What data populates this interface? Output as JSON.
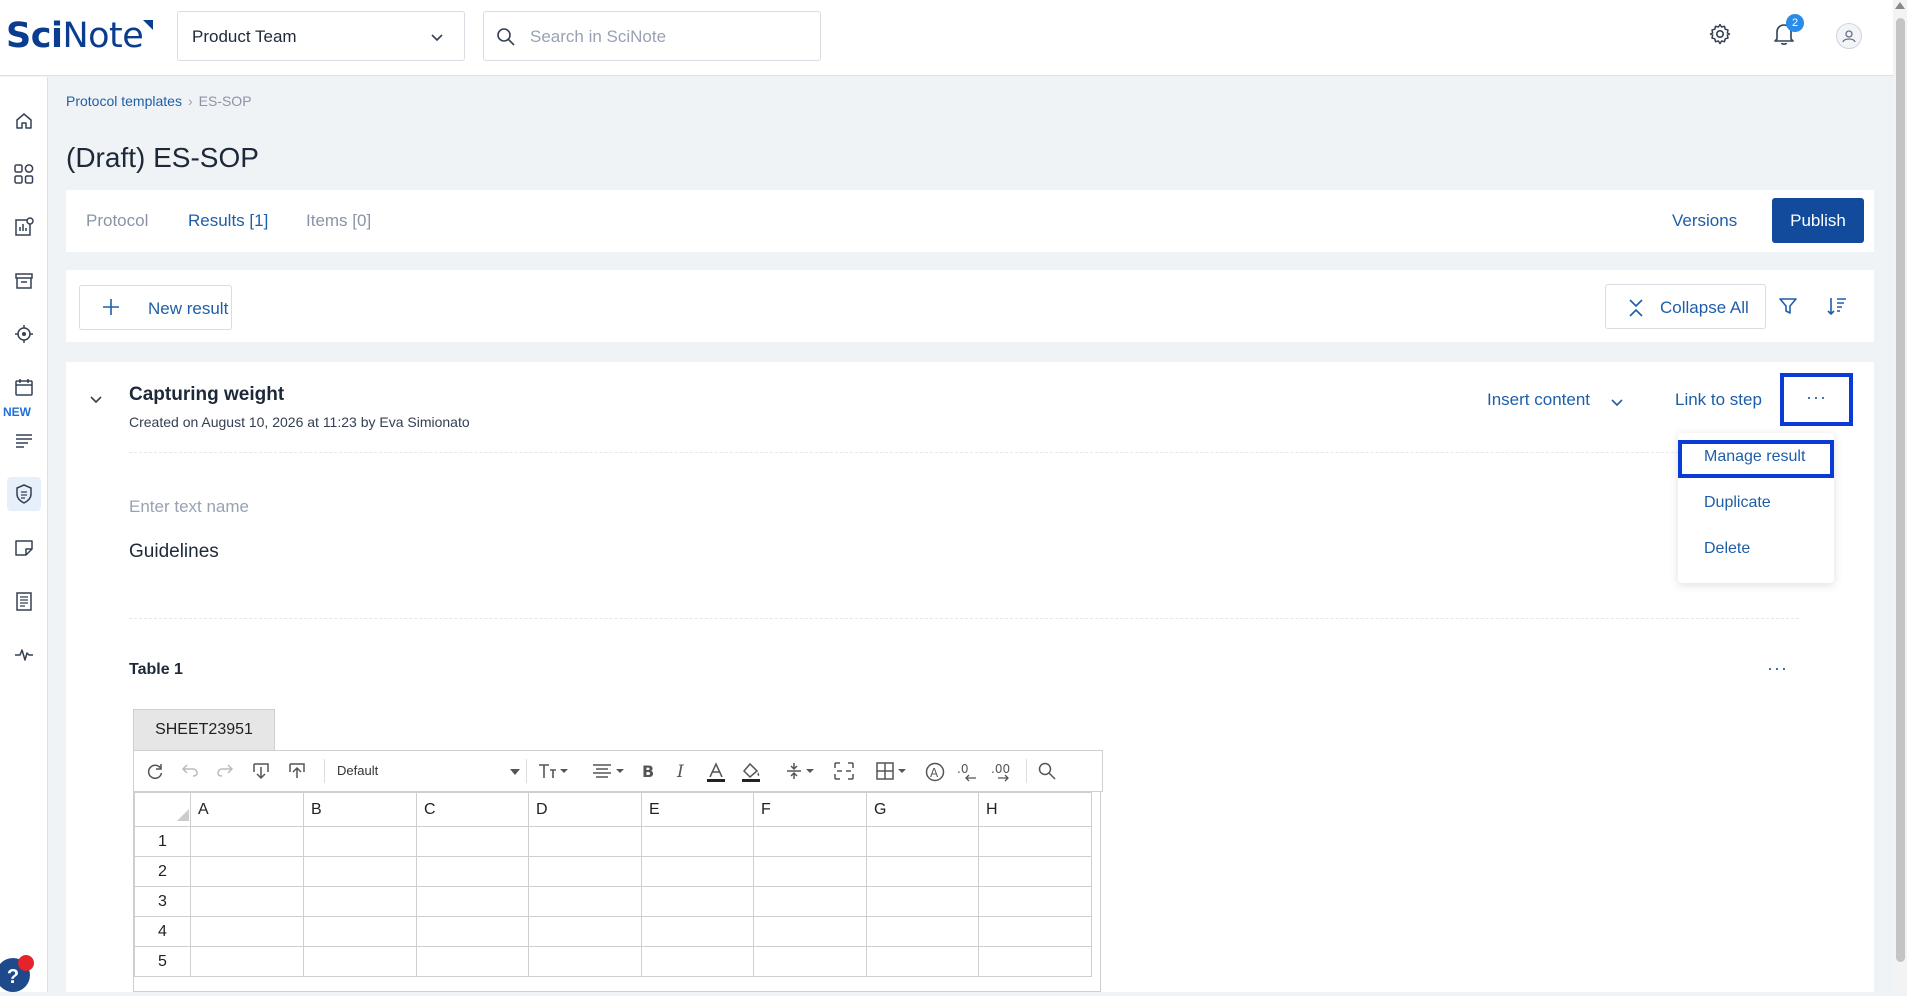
{
  "app": {
    "logo_sci": "Sci",
    "logo_note": "Note",
    "team": "Product Team",
    "search_placeholder": "Search in SciNote",
    "notifications_count": "2"
  },
  "sidebar": {
    "new_label": "NEW",
    "items": [
      "home-icon",
      "dashboard-icon",
      "reports-icon",
      "archive-icon",
      "globe-icon",
      "calendar-icon",
      "list-icon",
      "protocols-icon",
      "note-icon",
      "document-icon",
      "activity-icon"
    ],
    "help": "?"
  },
  "breadcrumb": {
    "parent": "Protocol templates",
    "separator": "›",
    "current": "ES-SOP"
  },
  "page": {
    "title": "(Draft) ES-SOP"
  },
  "tabs": [
    {
      "label": "Protocol",
      "active": false
    },
    {
      "label": "Results [1]",
      "active": true
    },
    {
      "label": "Items [0]",
      "active": false
    }
  ],
  "header_actions": {
    "versions": "Versions",
    "publish": "Publish"
  },
  "toolbar": {
    "new_result": "New result",
    "collapse_all": "Collapse All"
  },
  "result": {
    "title": "Capturing weight",
    "meta": "Created on August 10, 2026 at 11:23 by Eva Simionato",
    "insert_content": "Insert content",
    "link_to_step": "Link to step",
    "more": "···",
    "text_placeholder": "Enter text name",
    "text_body": "Guidelines",
    "table_title": "Table 1",
    "table_more": "···"
  },
  "menu": {
    "items": [
      "Manage result",
      "Duplicate",
      "Delete"
    ]
  },
  "spreadsheet": {
    "sheet_tab": "SHEET23951",
    "font": "Default",
    "columns": [
      "A",
      "B",
      "C",
      "D",
      "E",
      "F",
      "G",
      "H"
    ],
    "rows": [
      "1",
      "2",
      "3",
      "4",
      "5"
    ]
  },
  "colors": {
    "accent": "#1e5ea8",
    "publish_bg": "#124a9c",
    "highlight": "#0b3bd6",
    "badge": "#2a8be8"
  }
}
